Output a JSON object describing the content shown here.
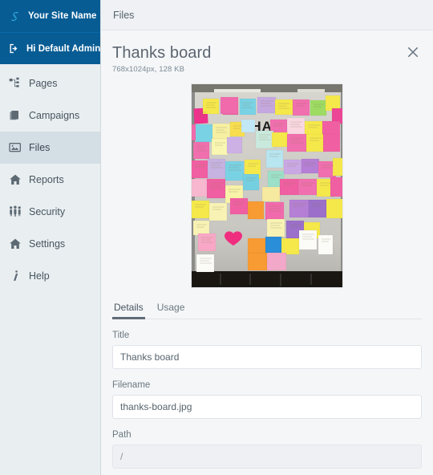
{
  "sidebar": {
    "brand": {
      "name": "Your Site Name",
      "logo_icon": "s-swirl-logo-icon",
      "bg_color": "#075c94"
    },
    "user": {
      "greeting": "Hi Default Admin",
      "icon": "logout-arrow-icon"
    },
    "items": [
      {
        "label": "Pages",
        "icon": "sitemap-icon",
        "active": false
      },
      {
        "label": "Campaigns",
        "icon": "pages-stack-icon",
        "active": false
      },
      {
        "label": "Files",
        "icon": "image-icon",
        "active": true
      },
      {
        "label": "Reports",
        "icon": "home-icon",
        "active": false
      },
      {
        "label": "Security",
        "icon": "people-icon",
        "active": false
      },
      {
        "label": "Settings",
        "icon": "home-icon",
        "active": false
      },
      {
        "label": "Help",
        "icon": "italic-i-icon",
        "active": false
      }
    ],
    "active_bg_color": "#d4dee5"
  },
  "topbar": {
    "title": "Files"
  },
  "detail_panel": {
    "title": "Thanks board",
    "meta": "768x1024px, 128 KB",
    "close_icon": "close-x-icon",
    "thumbnail": {
      "alt": "Whiteboard covered in colourful sticky notes with the word THANK visible",
      "word_on_board": "THANK"
    },
    "tabs": [
      {
        "label": "Details",
        "active": true
      },
      {
        "label": "Usage",
        "active": false
      }
    ],
    "fields": [
      {
        "label": "Title",
        "value": "Thanks board",
        "readonly": false
      },
      {
        "label": "Filename",
        "value": "thanks-board.jpg",
        "readonly": false
      },
      {
        "label": "Path",
        "value": "/",
        "readonly": true
      }
    ]
  }
}
